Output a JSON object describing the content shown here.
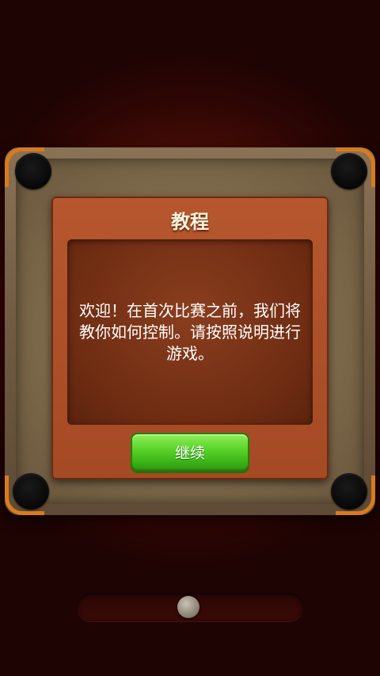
{
  "tutorial_dialog": {
    "title": "教程",
    "message": "欢迎！在首次比赛之前，我们将教你如何控制。请按照说明进行游戏。",
    "continue_label": "继续"
  },
  "colors": {
    "background": "#5a1208",
    "board_frame": "#7b6749",
    "corner_accent": "#d97b1c",
    "dialog": "#a44a24",
    "button_green": "#58d128"
  },
  "icons": [
    "pocket",
    "striker"
  ]
}
